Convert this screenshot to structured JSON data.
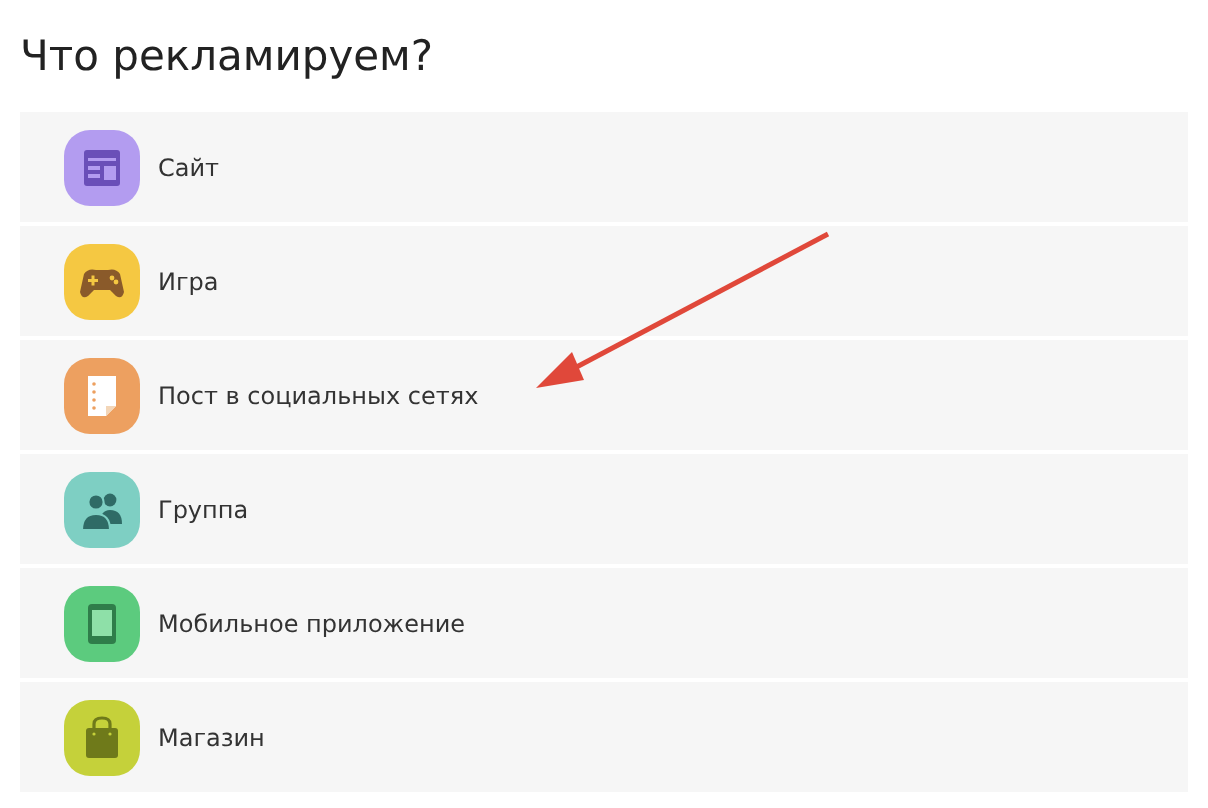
{
  "title": "Что рекламируем?",
  "options": [
    {
      "label": "Сайт",
      "kind": "site",
      "color": "#b39cf0"
    },
    {
      "label": "Игра",
      "kind": "game",
      "color": "#f5c842"
    },
    {
      "label": "Пост в социальных сетях",
      "kind": "post",
      "color": "#eda060"
    },
    {
      "label": "Группа",
      "kind": "group",
      "color": "#7ecfc3"
    },
    {
      "label": "Мобильное приложение",
      "kind": "app",
      "color": "#5ccb7e"
    },
    {
      "label": "Магазин",
      "kind": "shop",
      "color": "#c5d13a"
    }
  ],
  "annotation": {
    "kind": "arrow"
  }
}
